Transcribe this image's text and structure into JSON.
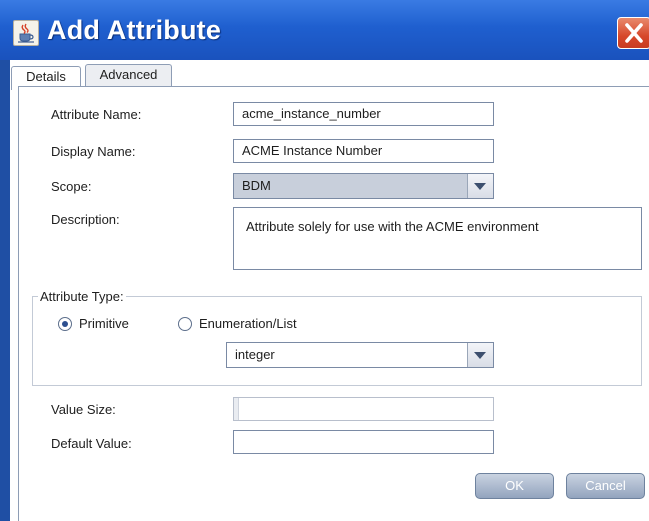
{
  "window": {
    "title": "Add Attribute",
    "icon": "java-cup-icon",
    "close_icon": "close-x-icon",
    "colors": {
      "titlebar": "#1f5fcf",
      "close": "#d7482b"
    }
  },
  "tabs": [
    {
      "label": "Details",
      "active": true
    },
    {
      "label": "Advanced",
      "active": false
    }
  ],
  "form": {
    "attribute_name": {
      "label": "Attribute Name:",
      "value": "acme_instance_number"
    },
    "display_name": {
      "label": "Display Name:",
      "value": "ACME Instance Number"
    },
    "scope": {
      "label": "Scope:",
      "value": "BDM"
    },
    "description": {
      "label": "Description:",
      "value": "Attribute solely for use with the ACME environment"
    }
  },
  "attribute_type": {
    "legend": "Attribute Type:",
    "options": [
      {
        "label": "Primitive",
        "selected": true
      },
      {
        "label": "Enumeration/List",
        "selected": false
      }
    ],
    "type_value": "integer"
  },
  "value_size": {
    "label": "Value Size:",
    "value": ""
  },
  "default_value": {
    "label": "Default Value:",
    "value": ""
  },
  "buttons": {
    "ok": "OK",
    "cancel": "Cancel"
  }
}
